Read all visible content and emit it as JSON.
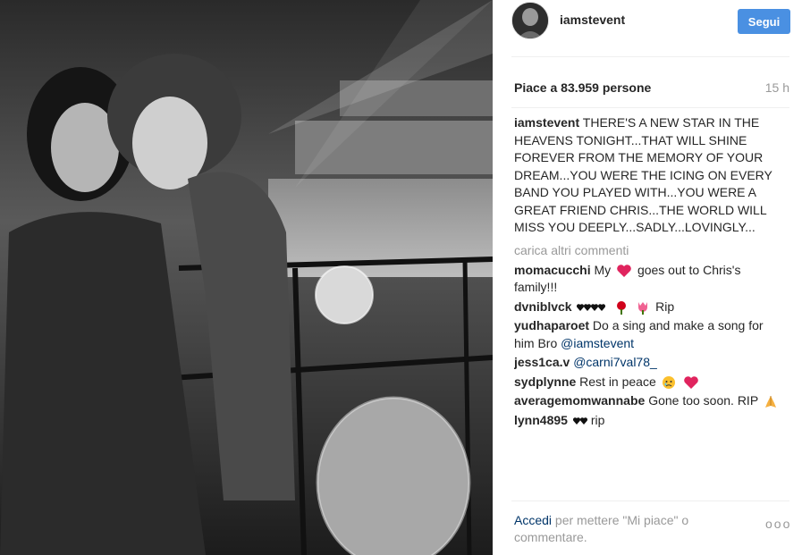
{
  "post": {
    "username": "iamstevent",
    "follow_label": "Segui",
    "likes_text": "Piace a 83.959 persone",
    "time_ago": "15 h",
    "caption_user": "iamstevent",
    "caption_text": "THERE'S A NEW STAR IN THE HEAVENS TONIGHT...THAT WILL SHINE FOREVER FROM THE MEMORY OF YOUR DREAM...YOU WERE THE ICING ON EVERY BAND YOU PLAYED WITH...YOU WERE A GREAT FRIEND CHRIS...THE WORLD WILL MISS YOU DEEPLY...SADLY...LOVINGLY...",
    "load_more": "carica altri commenti"
  },
  "comments": [
    {
      "user": "momacucchi",
      "pre": "My",
      "post": "goes out to Chris's family!!!"
    },
    {
      "user": "dvniblvck",
      "text": "Rip"
    },
    {
      "user": "yudhaparoet",
      "text": "Do a sing and make a song for him Bro",
      "mention": "@iamstevent"
    },
    {
      "user": "jess1ca.v",
      "mention": "@carni7val78_"
    },
    {
      "user": "sydplynne",
      "text": "Rest in peace"
    },
    {
      "user": "averagemomwannabe",
      "text": "Gone too soon. RIP"
    },
    {
      "user": "lynn4895",
      "text": "rip"
    }
  ],
  "footer": {
    "login_label": "Accedi",
    "rest": "per mettere \"Mi piace\" o commentare.",
    "more_dots": "ooo"
  },
  "colors": {
    "follow_button": "#4a90e2",
    "link": "#003569",
    "muted": "#999999",
    "heart": "#e0245e"
  },
  "icons": [
    "heart-emoji",
    "black-hearts-emoji",
    "rose-emoji",
    "tulip-emoji",
    "crying-face-emoji",
    "folded-hands-emoji",
    "more-options-icon"
  ]
}
